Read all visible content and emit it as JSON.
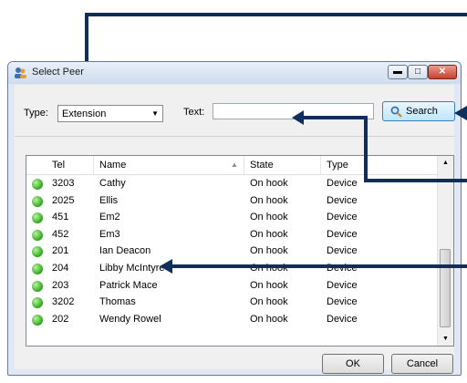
{
  "window": {
    "title": "Select Peer"
  },
  "filter": {
    "type_label": "Type:",
    "type_value": "Extension",
    "text_label": "Text:",
    "text_value": "",
    "search_label": "Search"
  },
  "list": {
    "columns": [
      "Tel",
      "Name",
      "State",
      "Type"
    ],
    "rows": [
      {
        "tel": "3203",
        "name": "Cathy",
        "state": "On hook",
        "type": "Device"
      },
      {
        "tel": "2025",
        "name": "Ellis",
        "state": "On hook",
        "type": "Device"
      },
      {
        "tel": "451",
        "name": "Em2",
        "state": "On hook",
        "type": "Device"
      },
      {
        "tel": "452",
        "name": "Em3",
        "state": "On hook",
        "type": "Device"
      },
      {
        "tel": "201",
        "name": "Ian Deacon",
        "state": "On hook",
        "type": "Device"
      },
      {
        "tel": "204",
        "name": "Libby McIntyre",
        "state": "On hook",
        "type": "Device"
      },
      {
        "tel": "203",
        "name": "Patrick Mace",
        "state": "On hook",
        "type": "Device"
      },
      {
        "tel": "3202",
        "name": "Thomas",
        "state": "On hook",
        "type": "Device"
      },
      {
        "tel": "202",
        "name": "Wendy Rowel",
        "state": "On hook",
        "type": "Device"
      }
    ]
  },
  "buttons": {
    "ok": "OK",
    "cancel": "Cancel"
  },
  "colors": {
    "annotation_arrow": "#0f2e5c",
    "status_on_hook": "#2fa51f"
  }
}
